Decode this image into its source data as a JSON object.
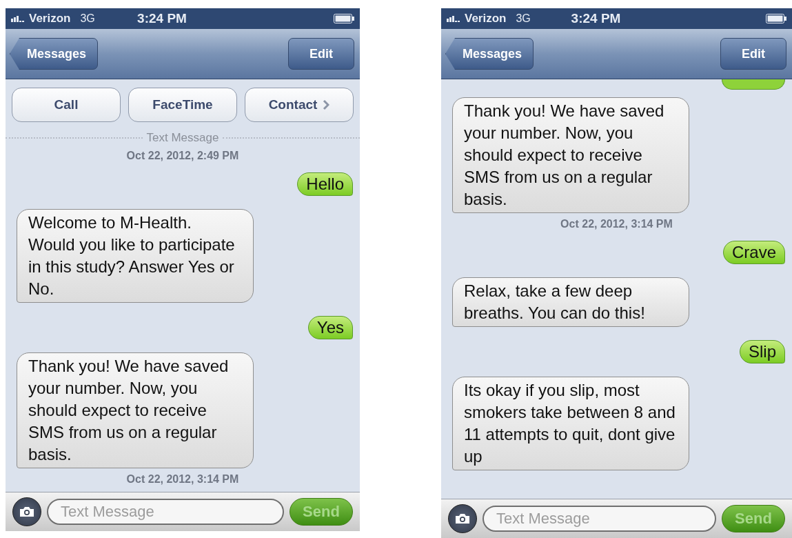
{
  "phones": [
    {
      "status_bar": {
        "carrier": "Verizon",
        "network": "3G",
        "time": "3:24 PM"
      },
      "nav": {
        "back": "Messages",
        "edit": "Edit"
      },
      "actions": [
        {
          "label": "Call",
          "chevron": false
        },
        {
          "label": "FaceTime",
          "chevron": false
        },
        {
          "label": "Contact",
          "chevron": true
        }
      ],
      "divider_label": "Text Message",
      "messages": [
        {
          "kind": "timestamp",
          "text": "Oct 22, 2012, 2:49 PM"
        },
        {
          "kind": "sent",
          "text": "Hello"
        },
        {
          "kind": "received",
          "text": "Welcome to M-Health. Would you like to participate in this study? Answer Yes or No."
        },
        {
          "kind": "sent",
          "text": "Yes"
        },
        {
          "kind": "received",
          "text": "Thank you! We have saved your number. Now, you should expect to receive SMS from us on a regular basis."
        },
        {
          "kind": "timestamp",
          "text": "Oct 22, 2012, 3:14 PM"
        }
      ],
      "input": {
        "placeholder": "Text Message",
        "send": "Send"
      }
    },
    {
      "status_bar": {
        "carrier": "Verizon",
        "network": "3G",
        "time": "3:24 PM"
      },
      "nav": {
        "back": "Messages",
        "edit": "Edit"
      },
      "messages": [
        {
          "kind": "clipped"
        },
        {
          "kind": "received",
          "text": "Thank you! We have saved your number. Now, you should expect to receive SMS from us on a regular basis."
        },
        {
          "kind": "timestamp",
          "text": "Oct 22, 2012, 3:14 PM"
        },
        {
          "kind": "sent",
          "text": "Crave"
        },
        {
          "kind": "received",
          "text": "Relax, take a few deep breaths. You can do this!"
        },
        {
          "kind": "sent",
          "text": "Slip"
        },
        {
          "kind": "received",
          "text": "Its okay if you slip, most smokers take between 8 and 11 attempts to quit, dont give up"
        }
      ],
      "input": {
        "placeholder": "Text Message",
        "send": "Send"
      }
    }
  ]
}
